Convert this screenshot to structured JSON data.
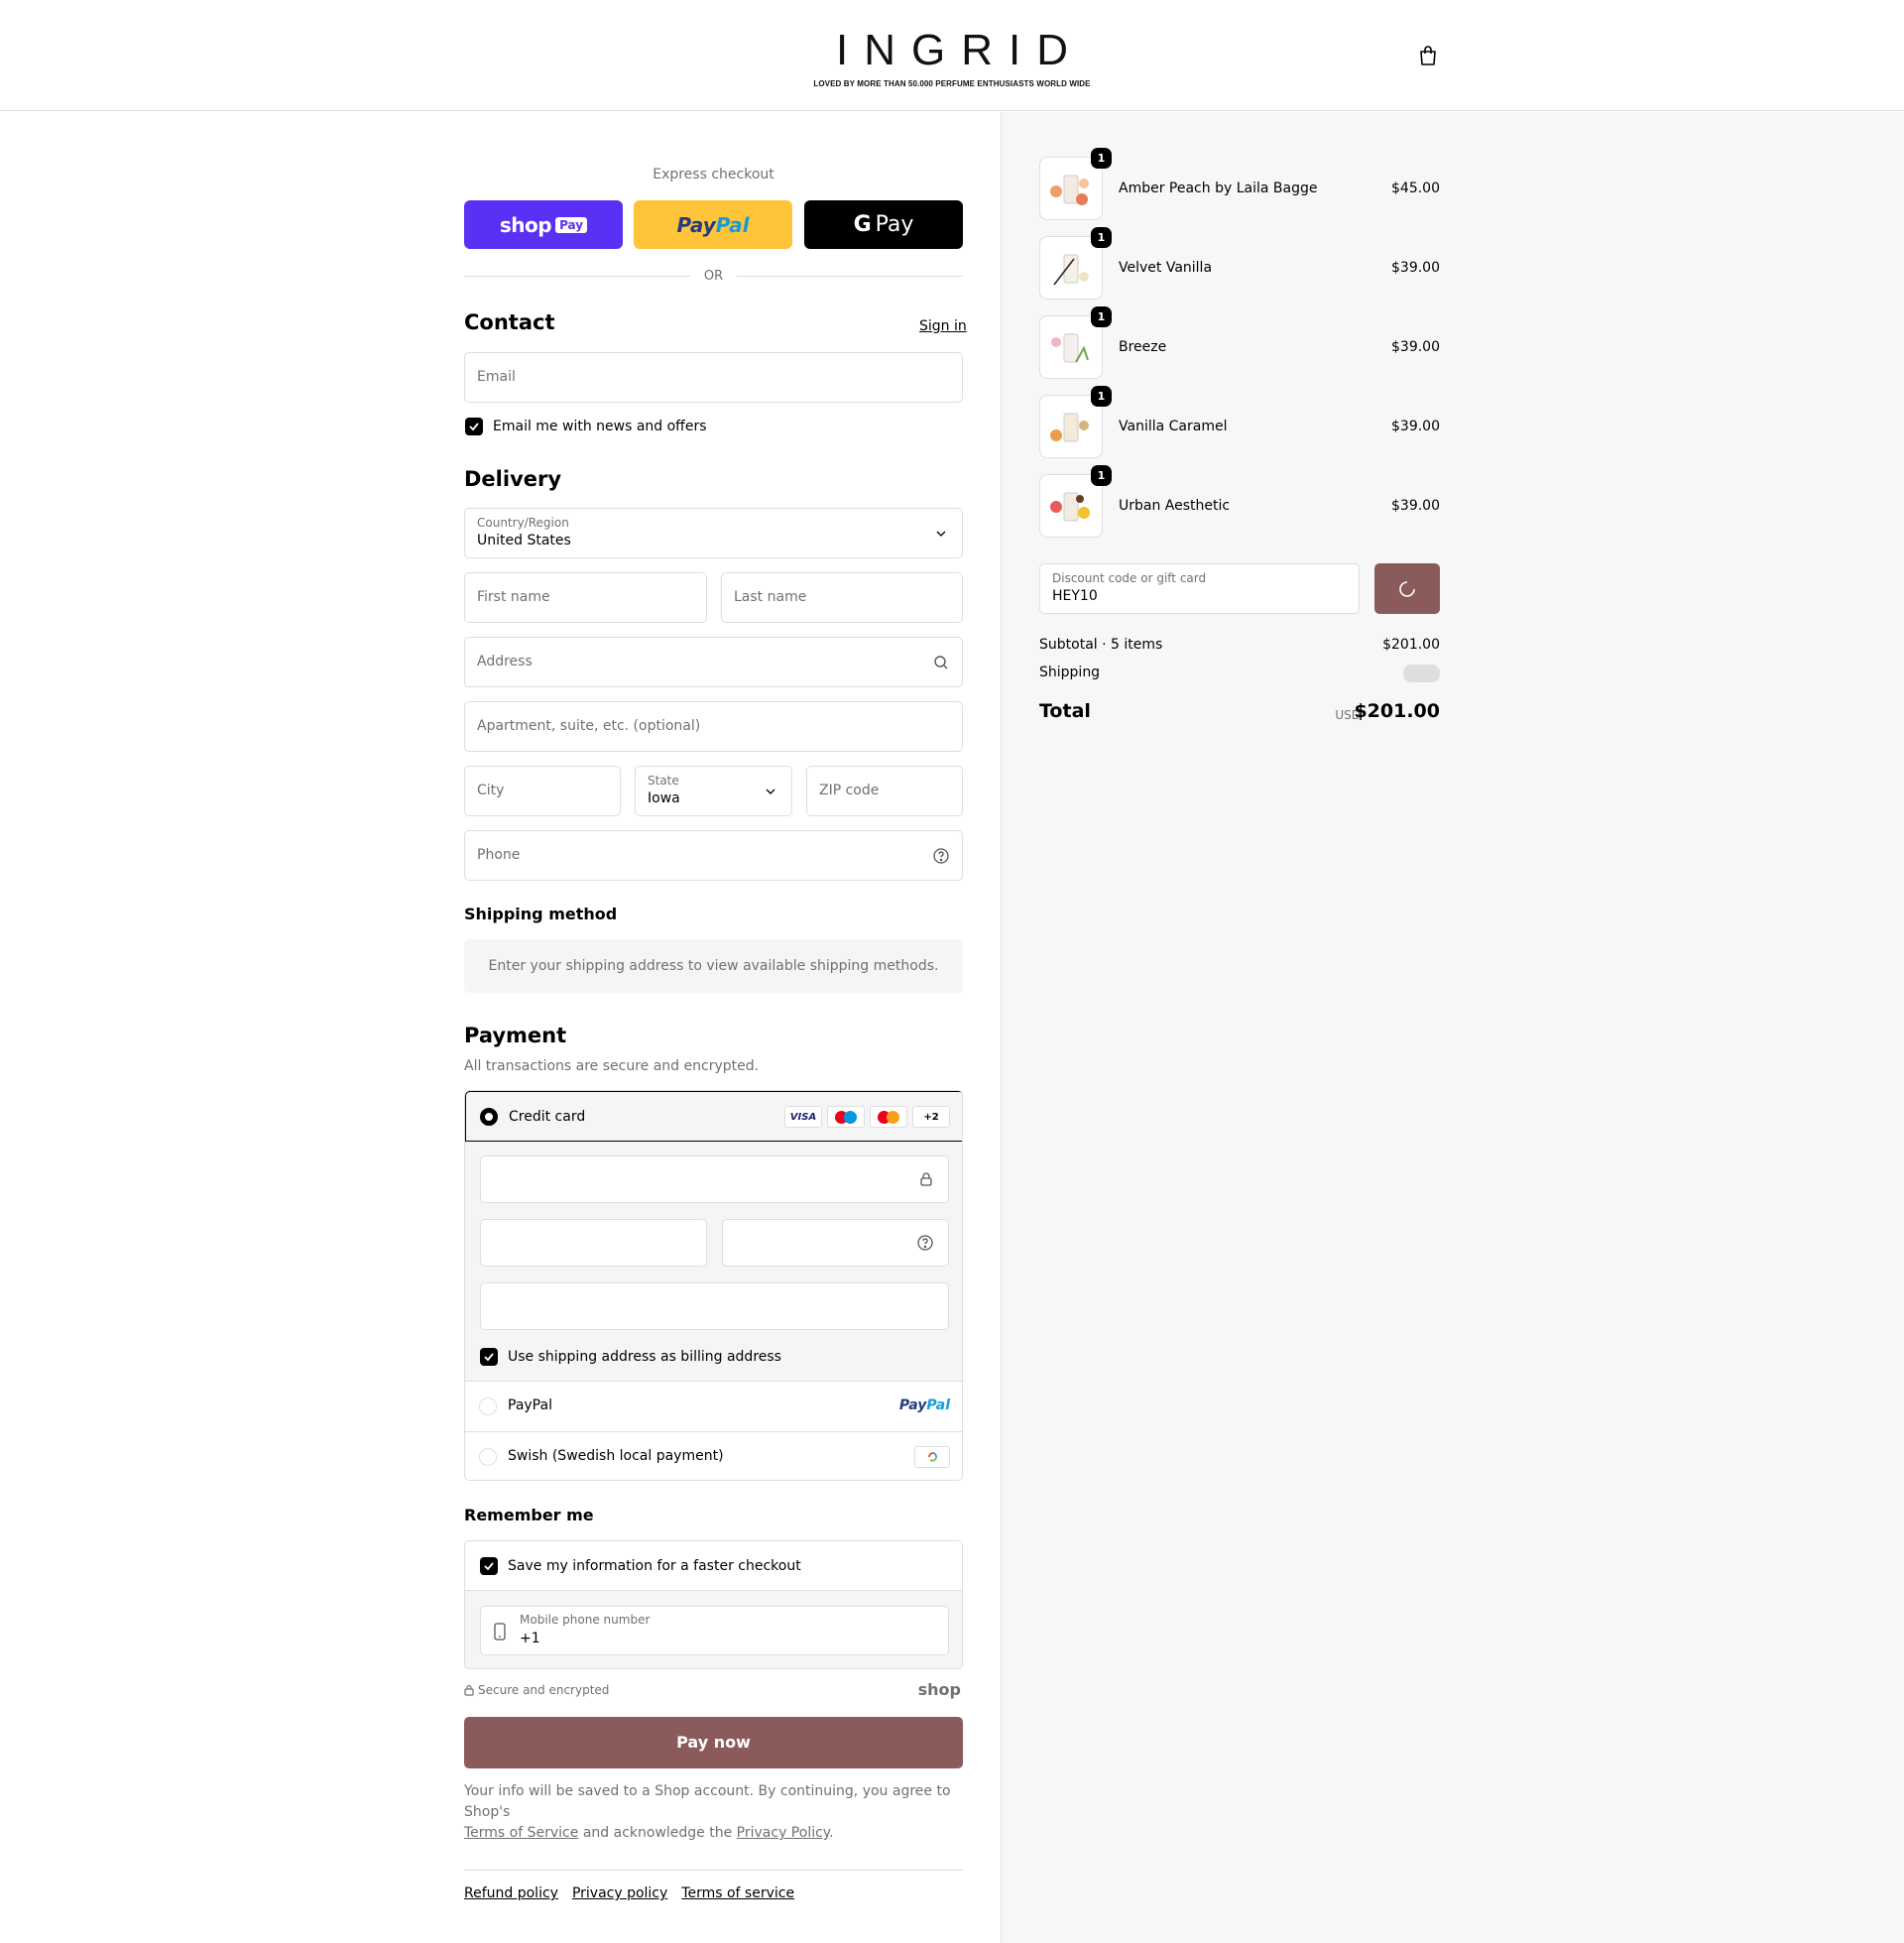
{
  "header": {
    "logo": "INGRID",
    "tagline": "LOVED BY MORE THAN 50.000 PERFUME ENTHUSIASTS WORLD WIDE",
    "cart_icon": "shopping-bag-icon"
  },
  "express": {
    "label": "Express checkout",
    "shop_pay": {
      "word": "shop",
      "chip": "Pay"
    },
    "paypal": {
      "part1": "Pay",
      "part2": "Pal"
    },
    "gpay": {
      "g": "G",
      "label": "Pay"
    },
    "or": "OR"
  },
  "contact": {
    "title": "Contact",
    "sign_in": "Sign in",
    "email_placeholder": "Email",
    "news_label": "Email me with news and offers"
  },
  "delivery": {
    "title": "Delivery",
    "country_label": "Country/Region",
    "country_value": "United States",
    "first_name": "First name",
    "last_name": "Last name",
    "address": "Address",
    "apartment": "Apartment, suite, etc. (optional)",
    "city": "City",
    "state_label": "State",
    "state_value": "Iowa",
    "zip": "ZIP code",
    "phone": "Phone"
  },
  "shipping_method": {
    "title": "Shipping method",
    "message": "Enter your shipping address to view available shipping methods."
  },
  "payment": {
    "title": "Payment",
    "subtitle": "All transactions are secure and encrypted.",
    "credit_card": "Credit card",
    "visa": "VISA",
    "more_cards": "+2",
    "billing_label": "Use shipping address as billing address",
    "paypal": "PayPal",
    "swish": "Swish (Swedish local payment)"
  },
  "remember": {
    "title": "Remember me",
    "save_label": "Save my information for a faster checkout",
    "mobile_label": "Mobile phone number",
    "mobile_value": "+1"
  },
  "secure": {
    "text": "Secure and encrypted",
    "shop": "shop"
  },
  "pay_now": "Pay now",
  "legal": {
    "text1": "Your info will be saved to a Shop account. By continuing, you agree to Shop's",
    "tos": "Terms of Service",
    "text2": "and acknowledge the",
    "privacy": "Privacy Policy",
    "text3": "."
  },
  "footer": {
    "refund": "Refund policy",
    "privacy": "Privacy policy",
    "terms": "Terms of service"
  },
  "cart": {
    "items": [
      {
        "name": "Amber Peach by Laila Bagge",
        "price": "$45.00",
        "qty": "1"
      },
      {
        "name": "Velvet Vanilla",
        "price": "$39.00",
        "qty": "1"
      },
      {
        "name": "Breeze",
        "price": "$39.00",
        "qty": "1"
      },
      {
        "name": "Vanilla Caramel",
        "price": "$39.00",
        "qty": "1"
      },
      {
        "name": "Urban Aesthetic",
        "price": "$39.00",
        "qty": "1"
      }
    ],
    "discount_label": "Discount code or gift card",
    "discount_value": "HEY10",
    "subtotal_label": "Subtotal · 5 items",
    "subtotal_value": "$201.00",
    "shipping_label": "Shipping",
    "total_label": "Total",
    "currency": "USD",
    "total_value": "$201.00"
  },
  "colors": {
    "accent": "#8b5a5a",
    "shop_pay": "#5a31f4",
    "paypal": "#ffc439",
    "border": "#dedede",
    "muted": "#707070",
    "panel": "#f7f7f7"
  }
}
